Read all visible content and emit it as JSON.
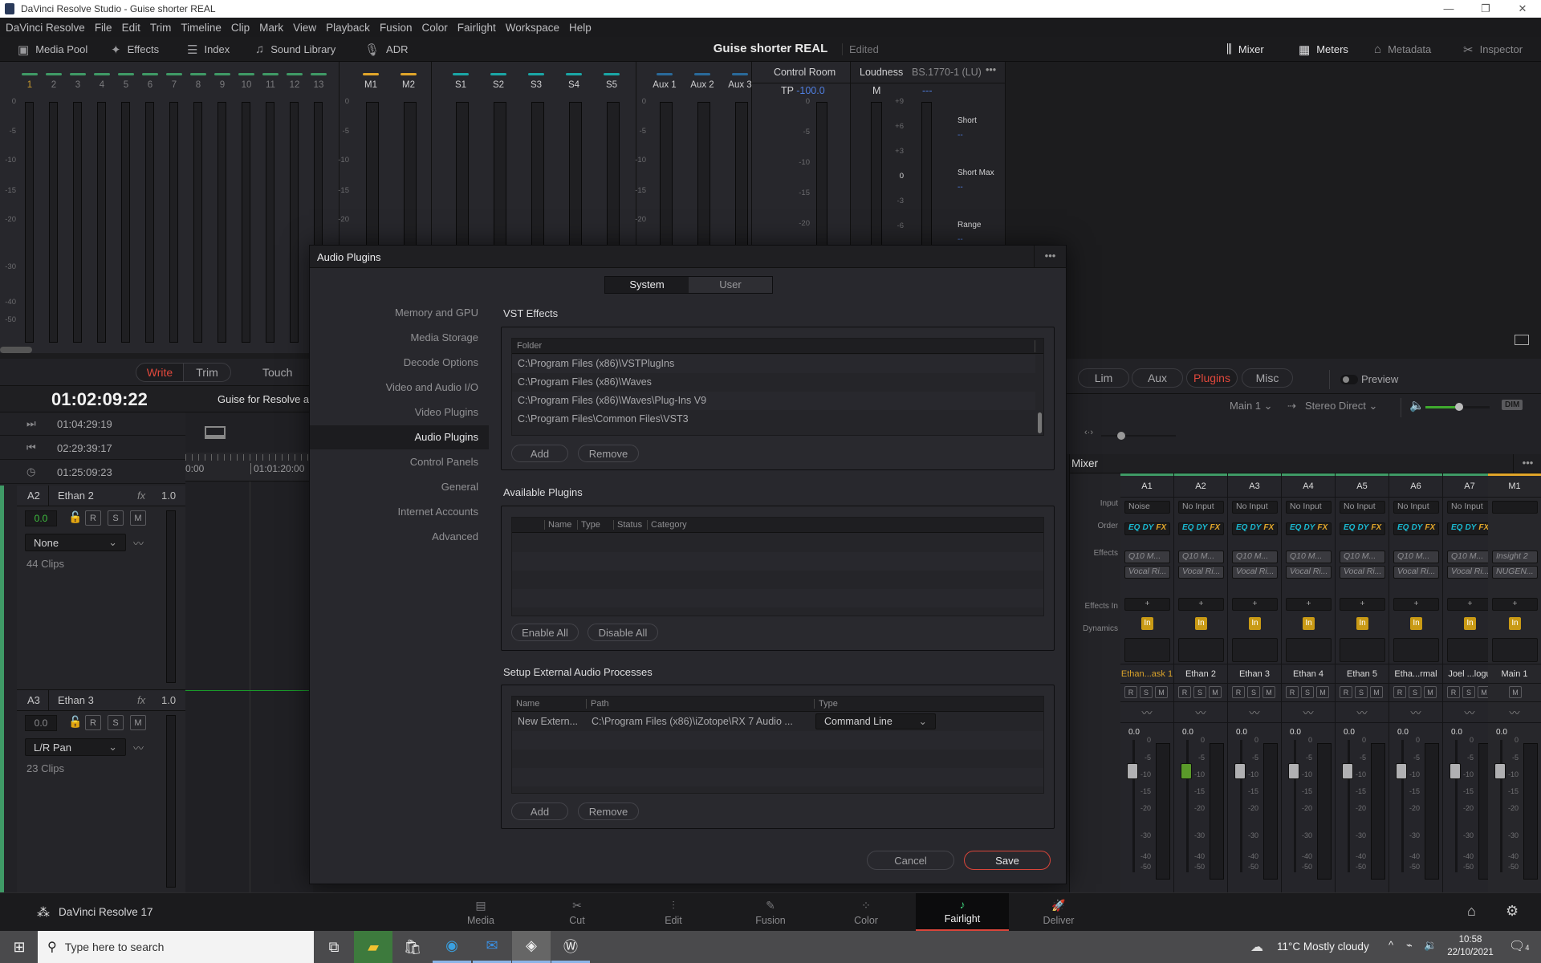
{
  "window": {
    "title": "DaVinci Resolve Studio - Guise shorter REAL",
    "controls": [
      "—",
      "❐",
      "✕"
    ]
  },
  "menu": [
    "DaVinci Resolve",
    "File",
    "Edit",
    "Trim",
    "Timeline",
    "Clip",
    "Mark",
    "View",
    "Playback",
    "Fusion",
    "Color",
    "Fairlight",
    "Workspace",
    "Help"
  ],
  "toolbar": {
    "left": [
      {
        "label": "Media Pool",
        "icon": "media-pool-icon",
        "glyph": "▣"
      },
      {
        "label": "Effects",
        "icon": "effects-wand-icon",
        "glyph": "✦"
      },
      {
        "label": "Index",
        "icon": "index-list-icon",
        "glyph": "☰"
      },
      {
        "label": "Sound Library",
        "icon": "sound-library-icon",
        "glyph": "♫"
      },
      {
        "label": "ADR",
        "icon": "microphone-icon",
        "glyph": "🎙"
      }
    ],
    "project_title": "Guise shorter REAL",
    "project_status": "Edited",
    "right": [
      {
        "label": "Mixer",
        "icon": "mixer-icon",
        "glyph": "⫼"
      },
      {
        "label": "Meters",
        "icon": "meters-icon",
        "glyph": "▦"
      },
      {
        "label": "Metadata",
        "icon": "metadata-tag-icon",
        "glyph": "⌂"
      },
      {
        "label": "Inspector",
        "icon": "inspector-icon",
        "glyph": "✂"
      }
    ]
  },
  "meters": {
    "scale": [
      "0",
      "-5",
      "-10",
      "-15",
      "-20",
      "-30",
      "-40",
      "-50"
    ],
    "tracks": [
      "1",
      "2",
      "3",
      "4",
      "5",
      "6",
      "7",
      "8",
      "9",
      "10",
      "11",
      "12",
      "13"
    ],
    "mains": [
      "M1",
      "M2"
    ],
    "subs": [
      "S1",
      "S2",
      "S3",
      "S4",
      "S5"
    ],
    "aux": [
      "Aux 1",
      "Aux 2",
      "Aux 3"
    ],
    "colors": {
      "track": "#3f9a66",
      "main": "#e0a52a",
      "sub": "#1aa6a6",
      "aux": "#2a6a9a",
      "active_label": "#c99a2e"
    },
    "control_room": {
      "title": "Control Room",
      "tp_label": "TP",
      "tp_value": "-100.0"
    },
    "loudness": {
      "title": "Loudness",
      "standard": "BS.1770-1 (LU)",
      "m_label": "M",
      "m_value": "---",
      "scale": [
        "+9",
        "+6",
        "+3",
        "0",
        "-3",
        "-6"
      ],
      "stats": [
        {
          "label": "Short",
          "value": "--"
        },
        {
          "label": "Short Max",
          "value": "--"
        },
        {
          "label": "Range",
          "value": "--"
        }
      ]
    }
  },
  "automation": {
    "write": "Write",
    "trim": "Trim",
    "touch": "Touch"
  },
  "timecode": {
    "main": "01:02:09:22",
    "timeline_name": "Guise for Resolve a",
    "rows": [
      {
        "icon": "in-point-icon",
        "glyph": "⏭",
        "value": "01:04:29:19"
      },
      {
        "icon": "out-point-icon",
        "glyph": "⏮",
        "value": "02:29:39:17"
      },
      {
        "icon": "duration-clock-icon",
        "glyph": "◷",
        "value": "01:25:09:23"
      }
    ],
    "ruler": [
      "0:00",
      "01:01:20:00"
    ]
  },
  "tracks": [
    {
      "id": "A2",
      "name": "Ethan 2",
      "fx": "fx",
      "level": "1.0",
      "gain": "0.0",
      "gain_active": true,
      "pan": "None",
      "clips": "44 Clips"
    },
    {
      "id": "A3",
      "name": "Ethan 3",
      "fx": "fx",
      "level": "1.0",
      "gain": "0.0",
      "gain_active": false,
      "pan": "L/R Pan",
      "clips": "23 Clips"
    }
  ],
  "track_buttons": [
    "R",
    "S",
    "M"
  ],
  "mixer_tabs": {
    "items": [
      "Lim",
      "Aux",
      "Plugins",
      "Misc"
    ],
    "active": "Plugins",
    "preview": "Preview"
  },
  "monitor": {
    "source": "Main 1",
    "dest": "Stereo Direct",
    "volume_percent": 52,
    "dim": "DIM",
    "scrub_percent": 27
  },
  "mixer": {
    "title": "Mixer",
    "row_labels": [
      "Input",
      "Order",
      "Effects",
      "Effects In",
      "Dynamics"
    ],
    "order": [
      "EQ",
      "DY",
      "FX"
    ],
    "effects_in": "In",
    "add": "+",
    "channels": [
      {
        "id": "A1",
        "input": "Noise",
        "effects": [
          "Q10 M...",
          "Vocal Ri..."
        ],
        "name": "Ethan...ask 1",
        "name_active": true,
        "fader": "0.0",
        "fader_green": false
      },
      {
        "id": "A2",
        "input": "No Input",
        "effects": [
          "Q10 M...",
          "Vocal Ri..."
        ],
        "name": "Ethan 2",
        "fader": "0.0",
        "fader_green": true
      },
      {
        "id": "A3",
        "input": "No Input",
        "effects": [
          "Q10 M...",
          "Vocal Ri..."
        ],
        "name": "Ethan 3",
        "fader": "0.0"
      },
      {
        "id": "A4",
        "input": "No Input",
        "effects": [
          "Q10 M...",
          "Vocal Ri..."
        ],
        "name": "Ethan 4",
        "fader": "0.0"
      },
      {
        "id": "A5",
        "input": "No Input",
        "effects": [
          "Q10 M...",
          "Vocal Ri..."
        ],
        "name": "Ethan 5",
        "fader": "0.0"
      },
      {
        "id": "A6",
        "input": "No Input",
        "effects": [
          "Q10 M...",
          "Vocal Ri..."
        ],
        "name": "Etha...rmal",
        "fader": "0.0"
      },
      {
        "id": "A7",
        "input": "No Input",
        "effects": [
          "Q10 M...",
          "Vocal Ri..."
        ],
        "name": "Joel ...logu",
        "fader": "0.0"
      },
      {
        "id": "M1",
        "input": "",
        "effects": [
          "Insight 2",
          "NUGEN..."
        ],
        "name": "Main 1",
        "fader": "0.0",
        "is_main": true
      }
    ],
    "fader_scale": [
      "0",
      "-5",
      "-10",
      "-15",
      "-20",
      "-30",
      "-40",
      "-50"
    ]
  },
  "dialog": {
    "title": "Audio Plugins",
    "tabs": [
      "System",
      "User"
    ],
    "active_tab": "System",
    "nav": [
      "Memory and GPU",
      "Media Storage",
      "Decode Options",
      "Video and Audio I/O",
      "Video Plugins",
      "Audio Plugins",
      "Control Panels",
      "General",
      "Internet Accounts",
      "Advanced"
    ],
    "nav_selected": "Audio Plugins",
    "vst": {
      "title": "VST Effects",
      "header": "Folder",
      "rows": [
        "C:\\Program Files (x86)\\VSTPlugIns",
        "C:\\Program Files (x86)\\Waves",
        "C:\\Program Files (x86)\\Waves\\Plug-Ins V9",
        "C:\\Program Files\\Common Files\\VST3"
      ],
      "add": "Add",
      "remove": "Remove"
    },
    "available": {
      "title": "Available Plugins",
      "columns": [
        "Name",
        "Type",
        "Status",
        "Category"
      ],
      "enable_all": "Enable All",
      "disable_all": "Disable All"
    },
    "external": {
      "title": "Setup External Audio Processes",
      "columns": [
        "Name",
        "Path",
        "Type"
      ],
      "rows": [
        {
          "name": "New Extern...",
          "path": "C:\\Program Files (x86)\\iZotope\\RX 7 Audio ...",
          "type": "Command Line"
        }
      ],
      "add": "Add",
      "remove": "Remove"
    },
    "cancel": "Cancel",
    "save": "Save"
  },
  "pagebar": {
    "brand": "DaVinci Resolve 17",
    "pages": [
      {
        "label": "Media",
        "glyph": "▤"
      },
      {
        "label": "Cut",
        "glyph": "✂"
      },
      {
        "label": "Edit",
        "glyph": "⫶"
      },
      {
        "label": "Fusion",
        "glyph": "✎"
      },
      {
        "label": "Color",
        "glyph": "⁘"
      },
      {
        "label": "Fairlight",
        "glyph": "♪"
      },
      {
        "label": "Deliver",
        "glyph": "🚀"
      }
    ],
    "active": "Fairlight"
  },
  "taskbar": {
    "search_placeholder": "Type here to search",
    "weather": "11°C  Mostly cloudy",
    "time": "10:58",
    "date": "22/10/2021",
    "notifications": "4"
  }
}
